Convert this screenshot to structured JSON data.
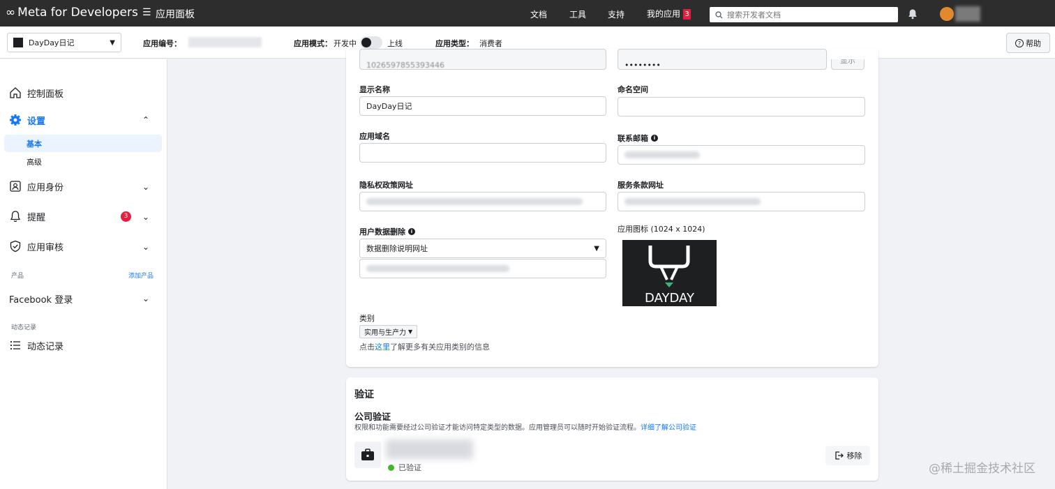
{
  "topbar": {
    "brand": "Meta for Developers",
    "dashboard": "应用面板",
    "nav": [
      "文档",
      "工具",
      "支持"
    ],
    "my_apps": "我的应用",
    "my_apps_badge": "3",
    "search_placeholder": "搜索开发者文档"
  },
  "subbar": {
    "app_name": "DayDay日记",
    "app_id_label": "应用编号：",
    "mode_label": "应用模式：",
    "mode_dev": "开发中",
    "mode_live": "上线",
    "type_label": "应用类型：",
    "type_value": "消费者",
    "help": "帮助"
  },
  "sidebar": {
    "dashboard": "控制面板",
    "settings": "设置",
    "settings_basic": "基本",
    "settings_advanced": "高级",
    "app_roles": "应用身份",
    "alerts": "提醒",
    "alerts_count": "3",
    "app_review": "应用审核",
    "products_section": "产品",
    "add_product": "添加产品",
    "facebook_login": "Facebook 登录",
    "activity_section": "动态记录",
    "activity_log": "动态记录"
  },
  "form": {
    "app_id_value": "1026597855393446",
    "secret_value": "••••••••",
    "show_label": "显示",
    "display_name_label": "显示名称",
    "display_name_value": "DayDay日记",
    "namespace_label": "命名空间",
    "namespace_value": "",
    "app_domain_label": "应用域名",
    "app_domain_value": "",
    "contact_email_label": "联系邮箱",
    "privacy_label": "隐私权政策网址",
    "tos_label": "服务条款网址",
    "user_data_deletion_label": "用户数据删除",
    "deletion_select_value": "数据删除说明网址",
    "app_icon_label": "应用图标 (1024 x 1024)",
    "app_icon_text": "DAYDAY",
    "category_label": "类别",
    "category_value": "实用与生产力",
    "category_help_prefix": "点击",
    "category_help_link": "这里",
    "category_help_suffix": "了解更多有关应用类别的信息"
  },
  "verification": {
    "title": "验证",
    "business_title": "公司验证",
    "business_desc": "权限和功能需要经过公司验证才能访问特定类型的数据。应用管理员可以随时开始验证流程。",
    "business_link": "详细了解公司验证",
    "status": "已验证",
    "remove": "移除"
  },
  "watermark": "@稀土掘金技术社区",
  "colors": {
    "topbar_bg": "#2d2d2e",
    "accent": "#1877f2",
    "alert_red": "#e41e3f",
    "verified_green": "#42b72a"
  }
}
